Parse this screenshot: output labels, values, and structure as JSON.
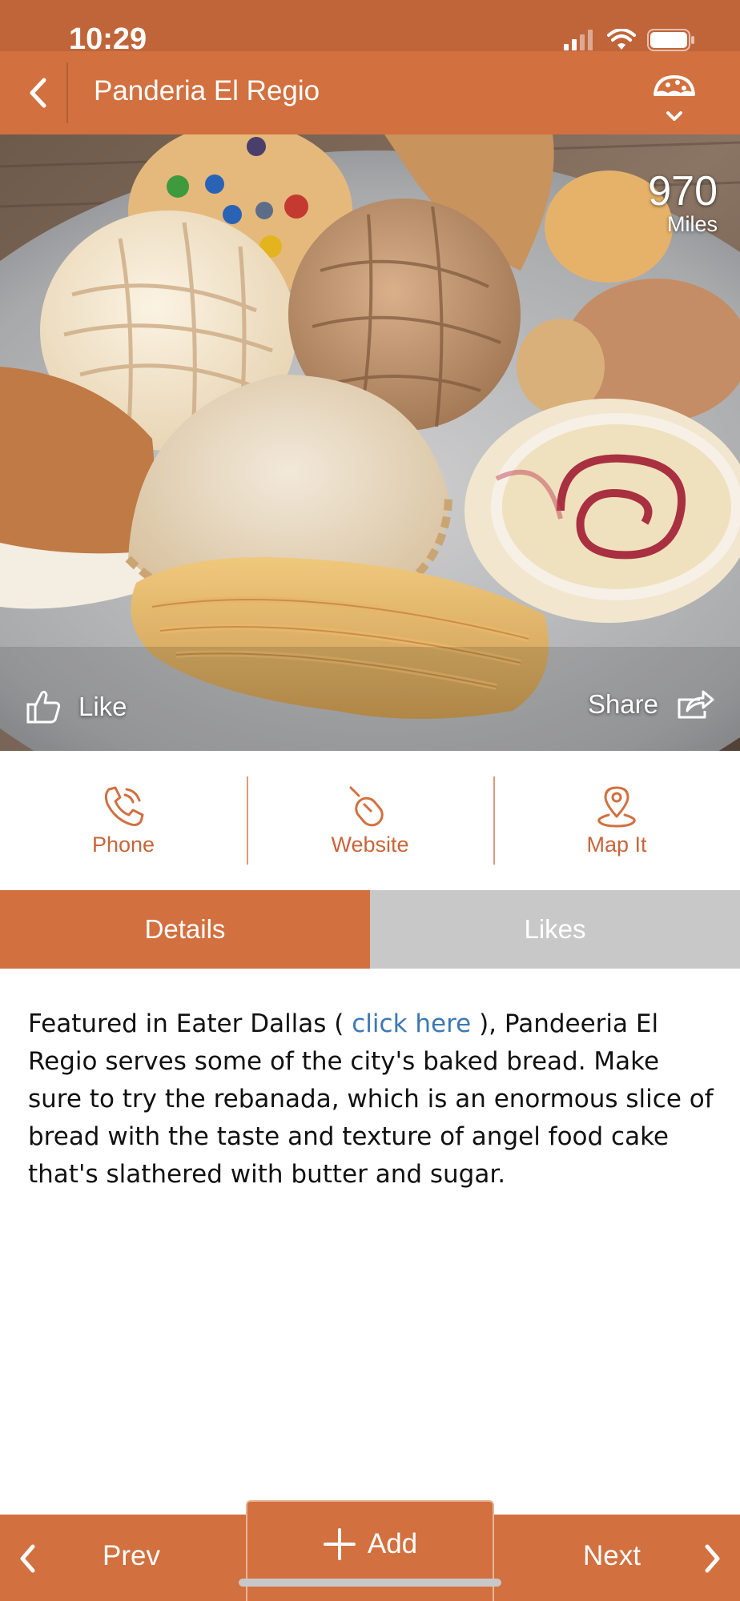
{
  "status_bar": {
    "time": "10:29"
  },
  "nav": {
    "title": "Panderia El Regio"
  },
  "hero": {
    "distance_value": "970",
    "distance_unit": "Miles",
    "like_label": "Like",
    "share_label": "Share"
  },
  "actions": [
    {
      "label": "Phone",
      "icon": "phone-icon"
    },
    {
      "label": "Website",
      "icon": "mouse-icon"
    },
    {
      "label": "Map It",
      "icon": "map-pin-icon"
    }
  ],
  "tabs": [
    {
      "label": "Details",
      "active": true
    },
    {
      "label": "Likes",
      "active": false
    }
  ],
  "description": {
    "before_link": "Featured in Eater Dallas ( ",
    "link_text": "click here",
    "after_link": " ), Pandeeria El Regio serves some of the city's baked bread.  Make sure to try the rebanada, which is an enormous slice of bread with the taste and texture of angel food cake that's slathered with butter and sugar."
  },
  "bottom": {
    "prev_label": "Prev",
    "add_label": "Add",
    "next_label": "Next"
  },
  "colors": {
    "brand": "#d2703f",
    "status_bar": "#c0653a",
    "inactive_tab": "#c8c8c8",
    "link": "#3c78b4"
  }
}
